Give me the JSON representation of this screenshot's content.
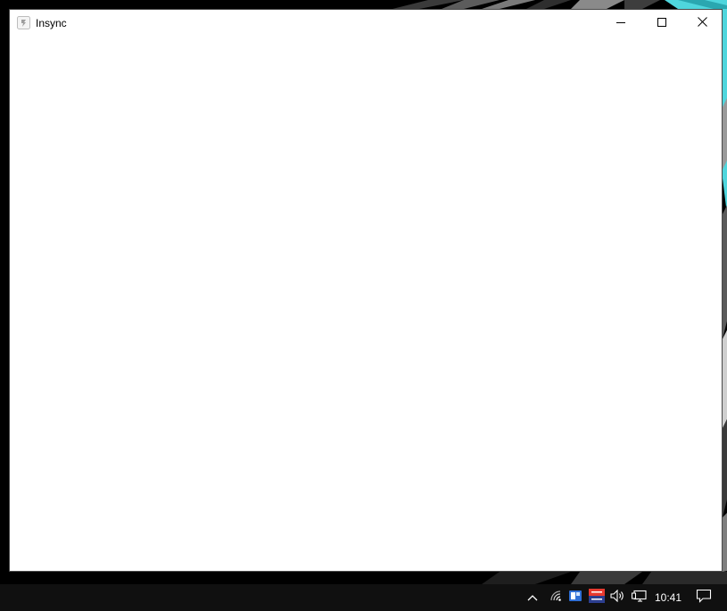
{
  "window": {
    "title": "Insync",
    "controls": {
      "minimize_icon": "minimize-icon",
      "maximize_icon": "maximize-icon",
      "close_icon": "close-icon"
    }
  },
  "taskbar": {
    "clock": "10:41",
    "tray_icons": [
      "chevron-up-icon",
      "network-icon",
      "app-tray-icon",
      "voice-writer-icon",
      "volume-icon",
      "display-icon",
      "notification-icon"
    ]
  },
  "colors": {
    "window_bg": "#ffffff",
    "taskbar_bg": "#101010",
    "accent_cyan": "#4fd6dd"
  }
}
